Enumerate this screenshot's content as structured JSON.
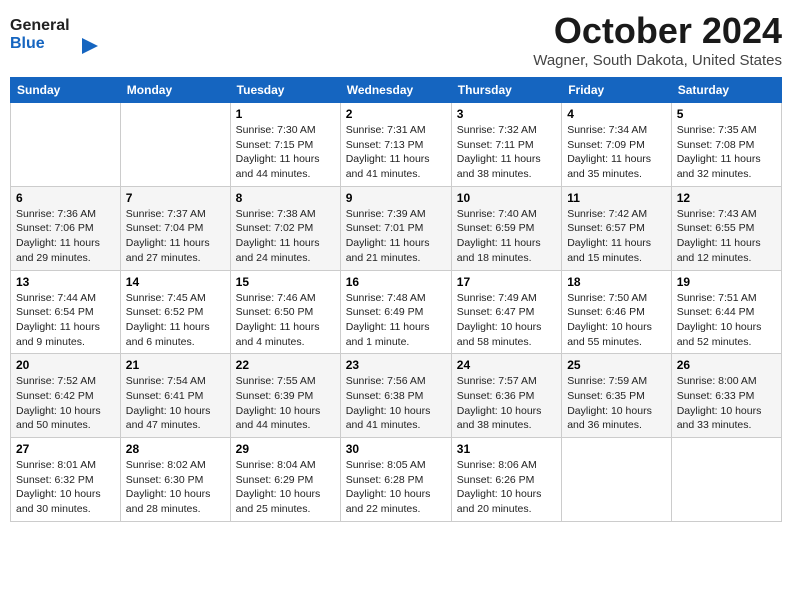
{
  "header": {
    "logo_line1": "General",
    "logo_line2": "Blue",
    "month": "October 2024",
    "location": "Wagner, South Dakota, United States"
  },
  "days_of_week": [
    "Sunday",
    "Monday",
    "Tuesday",
    "Wednesday",
    "Thursday",
    "Friday",
    "Saturday"
  ],
  "weeks": [
    [
      {
        "day": "",
        "details": ""
      },
      {
        "day": "",
        "details": ""
      },
      {
        "day": "1",
        "details": "Sunrise: 7:30 AM\nSunset: 7:15 PM\nDaylight: 11 hours and 44 minutes."
      },
      {
        "day": "2",
        "details": "Sunrise: 7:31 AM\nSunset: 7:13 PM\nDaylight: 11 hours and 41 minutes."
      },
      {
        "day": "3",
        "details": "Sunrise: 7:32 AM\nSunset: 7:11 PM\nDaylight: 11 hours and 38 minutes."
      },
      {
        "day": "4",
        "details": "Sunrise: 7:34 AM\nSunset: 7:09 PM\nDaylight: 11 hours and 35 minutes."
      },
      {
        "day": "5",
        "details": "Sunrise: 7:35 AM\nSunset: 7:08 PM\nDaylight: 11 hours and 32 minutes."
      }
    ],
    [
      {
        "day": "6",
        "details": "Sunrise: 7:36 AM\nSunset: 7:06 PM\nDaylight: 11 hours and 29 minutes."
      },
      {
        "day": "7",
        "details": "Sunrise: 7:37 AM\nSunset: 7:04 PM\nDaylight: 11 hours and 27 minutes."
      },
      {
        "day": "8",
        "details": "Sunrise: 7:38 AM\nSunset: 7:02 PM\nDaylight: 11 hours and 24 minutes."
      },
      {
        "day": "9",
        "details": "Sunrise: 7:39 AM\nSunset: 7:01 PM\nDaylight: 11 hours and 21 minutes."
      },
      {
        "day": "10",
        "details": "Sunrise: 7:40 AM\nSunset: 6:59 PM\nDaylight: 11 hours and 18 minutes."
      },
      {
        "day": "11",
        "details": "Sunrise: 7:42 AM\nSunset: 6:57 PM\nDaylight: 11 hours and 15 minutes."
      },
      {
        "day": "12",
        "details": "Sunrise: 7:43 AM\nSunset: 6:55 PM\nDaylight: 11 hours and 12 minutes."
      }
    ],
    [
      {
        "day": "13",
        "details": "Sunrise: 7:44 AM\nSunset: 6:54 PM\nDaylight: 11 hours and 9 minutes."
      },
      {
        "day": "14",
        "details": "Sunrise: 7:45 AM\nSunset: 6:52 PM\nDaylight: 11 hours and 6 minutes."
      },
      {
        "day": "15",
        "details": "Sunrise: 7:46 AM\nSunset: 6:50 PM\nDaylight: 11 hours and 4 minutes."
      },
      {
        "day": "16",
        "details": "Sunrise: 7:48 AM\nSunset: 6:49 PM\nDaylight: 11 hours and 1 minute."
      },
      {
        "day": "17",
        "details": "Sunrise: 7:49 AM\nSunset: 6:47 PM\nDaylight: 10 hours and 58 minutes."
      },
      {
        "day": "18",
        "details": "Sunrise: 7:50 AM\nSunset: 6:46 PM\nDaylight: 10 hours and 55 minutes."
      },
      {
        "day": "19",
        "details": "Sunrise: 7:51 AM\nSunset: 6:44 PM\nDaylight: 10 hours and 52 minutes."
      }
    ],
    [
      {
        "day": "20",
        "details": "Sunrise: 7:52 AM\nSunset: 6:42 PM\nDaylight: 10 hours and 50 minutes."
      },
      {
        "day": "21",
        "details": "Sunrise: 7:54 AM\nSunset: 6:41 PM\nDaylight: 10 hours and 47 minutes."
      },
      {
        "day": "22",
        "details": "Sunrise: 7:55 AM\nSunset: 6:39 PM\nDaylight: 10 hours and 44 minutes."
      },
      {
        "day": "23",
        "details": "Sunrise: 7:56 AM\nSunset: 6:38 PM\nDaylight: 10 hours and 41 minutes."
      },
      {
        "day": "24",
        "details": "Sunrise: 7:57 AM\nSunset: 6:36 PM\nDaylight: 10 hours and 38 minutes."
      },
      {
        "day": "25",
        "details": "Sunrise: 7:59 AM\nSunset: 6:35 PM\nDaylight: 10 hours and 36 minutes."
      },
      {
        "day": "26",
        "details": "Sunrise: 8:00 AM\nSunset: 6:33 PM\nDaylight: 10 hours and 33 minutes."
      }
    ],
    [
      {
        "day": "27",
        "details": "Sunrise: 8:01 AM\nSunset: 6:32 PM\nDaylight: 10 hours and 30 minutes."
      },
      {
        "day": "28",
        "details": "Sunrise: 8:02 AM\nSunset: 6:30 PM\nDaylight: 10 hours and 28 minutes."
      },
      {
        "day": "29",
        "details": "Sunrise: 8:04 AM\nSunset: 6:29 PM\nDaylight: 10 hours and 25 minutes."
      },
      {
        "day": "30",
        "details": "Sunrise: 8:05 AM\nSunset: 6:28 PM\nDaylight: 10 hours and 22 minutes."
      },
      {
        "day": "31",
        "details": "Sunrise: 8:06 AM\nSunset: 6:26 PM\nDaylight: 10 hours and 20 minutes."
      },
      {
        "day": "",
        "details": ""
      },
      {
        "day": "",
        "details": ""
      }
    ]
  ]
}
